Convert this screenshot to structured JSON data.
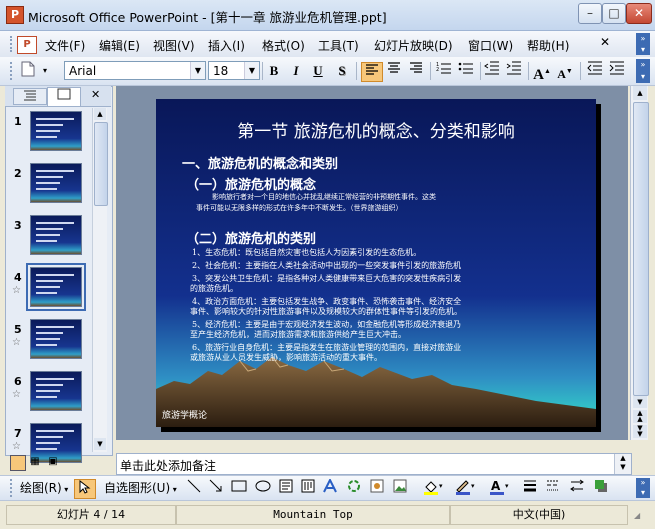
{
  "window": {
    "title": "Microsoft Office PowerPoint - [第十一章  旅游业危机管理.ppt]",
    "app_icon": "powerpoint-icon"
  },
  "menu": [
    "文件(F)",
    "编辑(E)",
    "视图(V)",
    "插入(I)",
    "格式(O)",
    "工具(T)",
    "幻灯片放映(D)",
    "窗口(W)",
    "帮助(H)"
  ],
  "toolbar": {
    "font_name": "Arial",
    "font_size": "18",
    "bold": "B",
    "italic": "I",
    "underline": "U",
    "shadow": "S",
    "grow_font": "A",
    "shrink_font": "A"
  },
  "thumbnails": [
    {
      "num": "1",
      "star": ""
    },
    {
      "num": "2",
      "star": ""
    },
    {
      "num": "3",
      "star": ""
    },
    {
      "num": "4",
      "star": "☆"
    },
    {
      "num": "5",
      "star": "☆"
    },
    {
      "num": "6",
      "star": "☆"
    },
    {
      "num": "7",
      "star": "☆"
    }
  ],
  "slide": {
    "title": "第一节 旅游危机的概念、分类和影响",
    "h1": "一、旅游危机的概念和类别",
    "h2a": "（一）旅游危机的概念",
    "def1": "影响旅行者对一个目的地信心并扰乱继续正常经营的非预期性事件。这类",
    "def2": "事件可能以无限多样的形式在许多年中不断发生。（世界旅游组织）",
    "h2b": "（二）旅游危机的类别",
    "items": [
      [
        "1、生态危机：既包括自然灾害也包括人为因素引发的生态危机。"
      ],
      [
        "2、社会危机：主要指在人类社会活动中出现的一些突发事件引发的旅游危机"
      ],
      [
        "3、突发公共卫生危机：是指各种对人类健康带来巨大危害的突发性疾病引发",
        "的旅游危机。"
      ],
      [
        "4、政治方面危机：主要包括发生战争、政变事件、恐怖袭击事件、经济安全",
        "事件、影响较大的针对性旅游事件以及规模较大的群体性事件等引发的危机。"
      ],
      [
        "5、经济危机：主要是由于宏观经济发生波动，如金融危机等形成经济衰退乃",
        "至产生经济危机，进而对旅游需求和旅游供给产生巨大冲击。"
      ],
      [
        "6、旅游行业自身危机：主要是指发生在旅游业管理的范围内，直接对旅游业",
        "或旅游从业人员发生威胁，影响旅游活动的重大事件。"
      ]
    ],
    "footer": "旅游学概论"
  },
  "notes_placeholder": "单击此处添加备注",
  "drawbar": {
    "draw_label": "绘图(R)",
    "autoshape_label": "自选图形(U)"
  },
  "status": {
    "slide_pos": "幻灯片 4 / 14",
    "design": "Mountain Top",
    "language": "中文(中国)"
  }
}
